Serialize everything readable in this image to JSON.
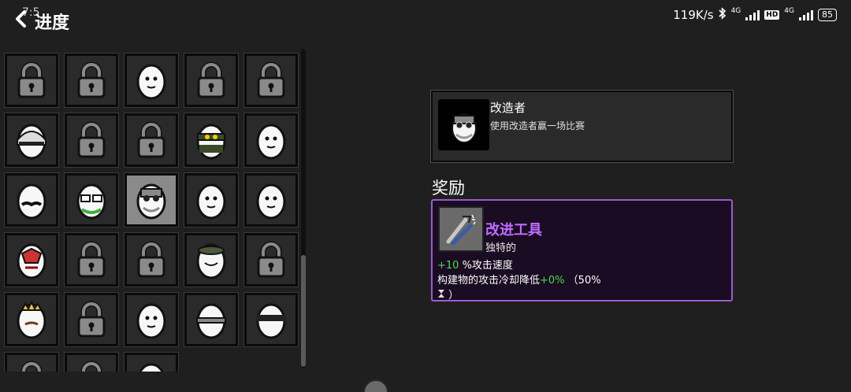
{
  "status": {
    "time": "7:5",
    "speed": "119K/s",
    "net1": "4G",
    "hd": "HD",
    "net2": "4G",
    "battery": "85"
  },
  "header": {
    "title": "进度"
  },
  "grid": {
    "cells": [
      {
        "icon": "lock-icon"
      },
      {
        "icon": "lock-icon"
      },
      {
        "icon": "egg-character-icon"
      },
      {
        "icon": "lock-icon"
      },
      {
        "icon": "lock-icon"
      },
      {
        "icon": "egg-helmet-icon"
      },
      {
        "icon": "lock-icon"
      },
      {
        "icon": "lock-icon"
      },
      {
        "icon": "egg-ninja-icon"
      },
      {
        "icon": "egg-grin-icon"
      },
      {
        "icon": "egg-mustache-icon"
      },
      {
        "icon": "egg-glasses-icon"
      },
      {
        "icon": "egg-engineer-icon",
        "selected": true
      },
      {
        "icon": "egg-character-icon"
      },
      {
        "icon": "egg-worried-icon"
      },
      {
        "icon": "egg-demon-icon"
      },
      {
        "icon": "lock-icon"
      },
      {
        "icon": "lock-icon"
      },
      {
        "icon": "egg-hat-icon"
      },
      {
        "icon": "lock-icon"
      },
      {
        "icon": "egg-king-icon"
      },
      {
        "icon": "lock-icon"
      },
      {
        "icon": "egg-character-icon"
      },
      {
        "icon": "egg-spiked-icon"
      },
      {
        "icon": "egg-bandit-icon"
      },
      {
        "icon": "lock-icon"
      },
      {
        "icon": "lock-icon"
      },
      {
        "icon": "egg-character-icon"
      }
    ]
  },
  "detail": {
    "character_name": "改造者",
    "character_desc": "使用改造者赢一场比赛",
    "reward_heading": "奖励",
    "item": {
      "name": "改进工具",
      "rarity": "独特的",
      "stat1_value": "+10",
      "stat1_text": " %攻击速度",
      "stat2_prefix": "构建物的攻击冷却降低",
      "stat2_value": "+0%",
      "stat2_suffix": " （50%",
      "stat3_text": "）",
      "stat3_icon": "hourglass-icon"
    }
  },
  "colors": {
    "accent": "#c06bff",
    "reward_border": "#9a5ccf",
    "positive": "#4bdc4b"
  }
}
